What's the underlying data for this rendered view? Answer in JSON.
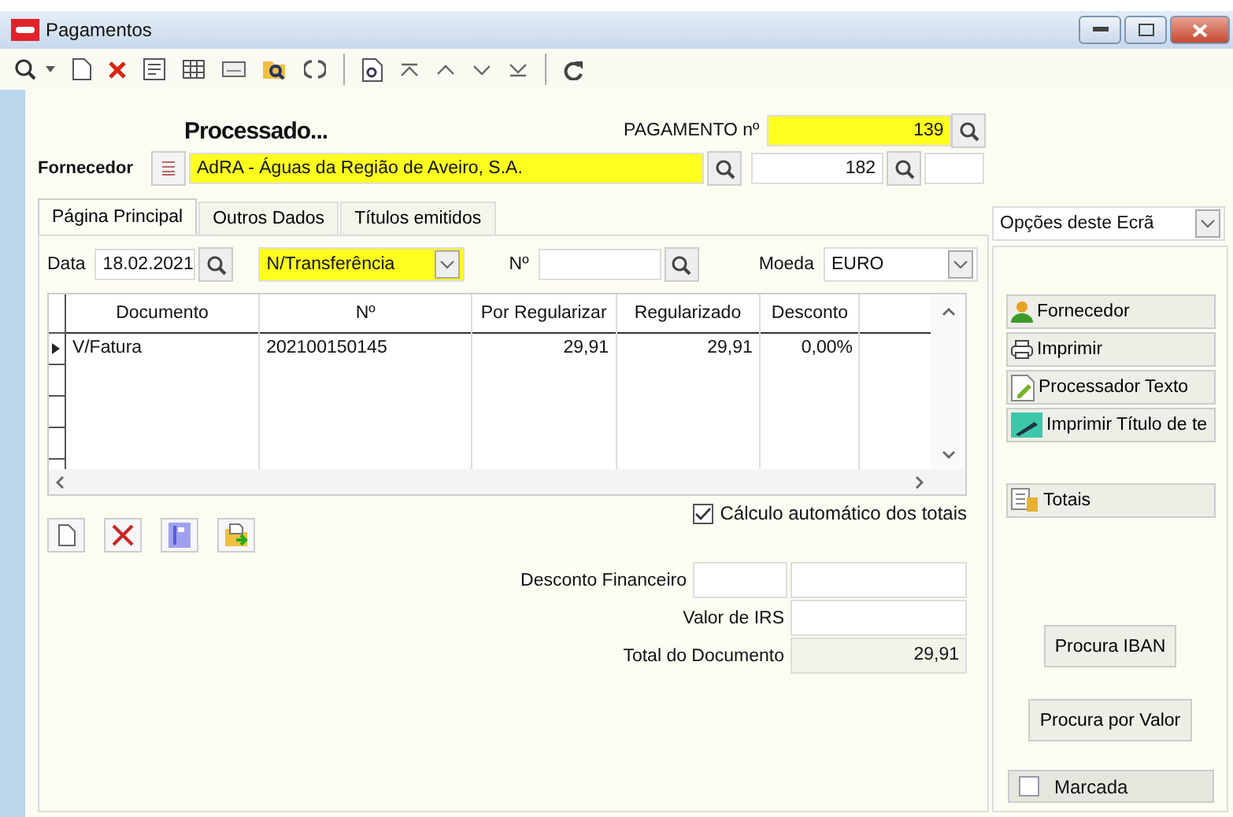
{
  "window": {
    "title": "Pagamentos"
  },
  "header": {
    "status": "Processado...",
    "payment_label": "PAGAMENTO nº",
    "payment_number": "139",
    "supplier_label": "Fornecedor",
    "supplier_name": "AdRA - Águas da Região de Aveiro, S.A.",
    "supplier_code": "182"
  },
  "tabs": [
    {
      "label": "Página Principal",
      "selected": true
    },
    {
      "label": "Outros Dados",
      "selected": false
    },
    {
      "label": "Títulos emitidos",
      "selected": false
    }
  ],
  "filters": {
    "date_label": "Data",
    "date": "18.02.2021",
    "type": "N/Transferência",
    "number_label": "Nº",
    "currency_label": "Moeda",
    "currency": "EURO"
  },
  "table": {
    "columns": [
      "Documento",
      "Nº",
      "Por Regularizar",
      "Regularizado",
      "Desconto"
    ],
    "rows": [
      {
        "cells": [
          "V/Fatura",
          "202100150145",
          "29,91",
          "29,91",
          "0,00%"
        ],
        "selected": true
      }
    ]
  },
  "auto_totals": {
    "label": "Cálculo automático dos totais",
    "checked": true
  },
  "totals": [
    {
      "label": "Desconto Financeiro",
      "kind": "double"
    },
    {
      "label": "Valor de IRS",
      "kind": "single"
    },
    {
      "label": "Total do Documento",
      "kind": "readonly",
      "value": "29,91"
    }
  ],
  "options": {
    "dropdown": "Opções deste Ecrã",
    "actions": [
      {
        "label": "Fornecedor",
        "kind": "person"
      },
      {
        "label": "Imprimir",
        "kind": "printer"
      },
      {
        "label": "Processador Texto",
        "kind": "document"
      },
      {
        "label": "Imprimir Título de te",
        "kind": "pen"
      },
      {
        "label": "Totais",
        "kind": "totals"
      }
    ],
    "buttons": [
      "Procura IBAN",
      "Procura por Valor"
    ],
    "marked": {
      "label": "Marcada",
      "checked": false
    }
  }
}
